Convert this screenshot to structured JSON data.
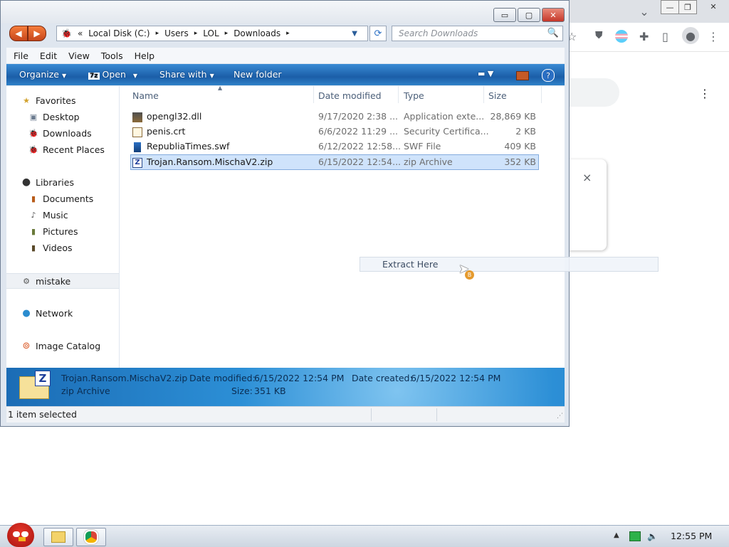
{
  "chrome": {
    "extension_icons": [
      "star-icon",
      "shield-icon",
      "flag-icon",
      "puzzle-icon",
      "sidepanel-icon",
      "profile-icon",
      "kebab-menu-icon"
    ],
    "close_symbol": "×"
  },
  "window": {
    "controls": {
      "minimize": "▭",
      "maximize": "▢",
      "close": "✕"
    },
    "address": {
      "chevrons": "«",
      "segments": [
        "Local Disk (C:)",
        "Users",
        "LOL",
        "Downloads"
      ],
      "separator": "▸"
    },
    "search_placeholder": "Search Downloads",
    "menu": [
      "File",
      "Edit",
      "View",
      "Tools",
      "Help"
    ],
    "command_bar": {
      "organize": "Organize",
      "open": "Open",
      "share_with": "Share with",
      "new_folder": "New folder"
    },
    "nav": {
      "favorites": {
        "label": "Favorites",
        "items": [
          "Desktop",
          "Downloads",
          "Recent Places"
        ]
      },
      "libraries": {
        "label": "Libraries",
        "items": [
          "Documents",
          "Music",
          "Pictures",
          "Videos"
        ]
      },
      "homegroup": "mistake",
      "network": "Network",
      "image_catalog": "Image Catalog"
    },
    "columns": [
      "Name",
      "Date modified",
      "Type",
      "Size"
    ],
    "files": [
      {
        "name": "opengl32.dll",
        "date": "9/17/2020 2:38 ...",
        "type": "Application exte...",
        "size": "28,869 KB",
        "icon": "dll-icon"
      },
      {
        "name": "penis.crt",
        "date": "6/6/2022 11:29 ...",
        "type": "Security Certifica...",
        "size": "2 KB",
        "icon": "certificate-icon"
      },
      {
        "name": "RepubliaTimes.swf",
        "date": "6/12/2022 12:58...",
        "type": "SWF File",
        "size": "409 KB",
        "icon": "swf-icon"
      },
      {
        "name": "Trojan.Ransom.MischaV2.zip",
        "date": "6/15/2022 12:54...",
        "type": "zip Archive",
        "size": "352 KB",
        "icon": "zip-icon",
        "selected": true
      }
    ],
    "details": {
      "filename": "Trojan.Ransom.MischaV2.zip",
      "type": "zip Archive",
      "date_modified_label": "Date modified:",
      "date_modified": "6/15/2022 12:54 PM",
      "date_created_label": "Date created:",
      "date_created": "6/15/2022 12:54 PM",
      "size_label": "Size:",
      "size": "351 KB"
    },
    "status": "1 item selected"
  },
  "drag": {
    "label": "Extract Here",
    "badge": "B"
  },
  "taskbar": {
    "clock": "12:55 PM"
  }
}
